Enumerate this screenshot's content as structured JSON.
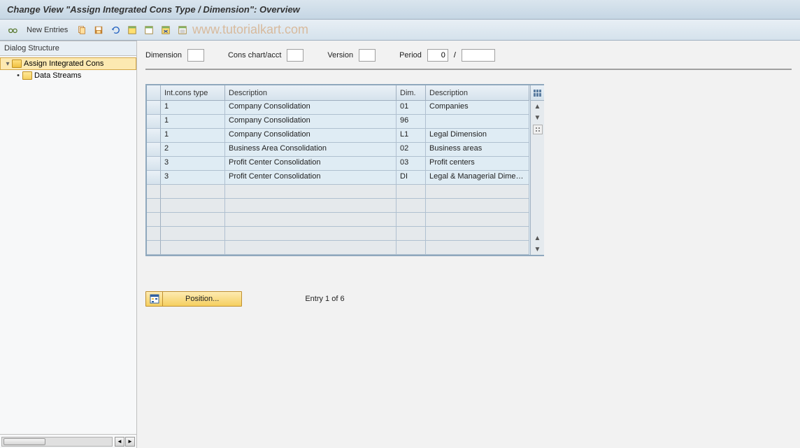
{
  "title": "Change View \"Assign Integrated Cons Type / Dimension\": Overview",
  "toolbar": {
    "new_entries": "New Entries"
  },
  "watermark": "www.tutorialkart.com",
  "sidebar": {
    "header": "Dialog Structure",
    "items": [
      {
        "label": "Assign Integrated Cons",
        "selected": true,
        "level": 0,
        "open": true
      },
      {
        "label": "Data Streams",
        "selected": false,
        "level": 1,
        "open": false
      }
    ]
  },
  "filters": {
    "dimension_label": "Dimension",
    "dimension_value": "",
    "cons_chart_label": "Cons chart/acct",
    "cons_chart_value": "",
    "version_label": "Version",
    "version_value": "",
    "period_label": "Period",
    "period_value1": "0",
    "period_sep": "/",
    "period_value2": ""
  },
  "table": {
    "headers": {
      "col1": "Int.cons type",
      "col2": "Description",
      "col3": "Dim.",
      "col4": "Description"
    },
    "rows": [
      {
        "col1": "1",
        "col2": "Company Consolidation",
        "col3": "01",
        "col4": "Companies"
      },
      {
        "col1": "1",
        "col2": "Company Consolidation",
        "col3": "96",
        "col4": ""
      },
      {
        "col1": "1",
        "col2": "Company Consolidation",
        "col3": "L1",
        "col4": "Legal Dimension"
      },
      {
        "col1": "2",
        "col2": "Business Area Consolidation",
        "col3": "02",
        "col4": "Business areas"
      },
      {
        "col1": "3",
        "col2": "Profit Center Consolidation",
        "col3": "03",
        "col4": "Profit centers"
      },
      {
        "col1": "3",
        "col2": "Profit Center Consolidation",
        "col3": "DI",
        "col4": "Legal & Managerial Dimensi.."
      }
    ],
    "empty_rows": 5
  },
  "footer": {
    "position_label": "Position...",
    "entry_text": "Entry 1 of 6"
  }
}
